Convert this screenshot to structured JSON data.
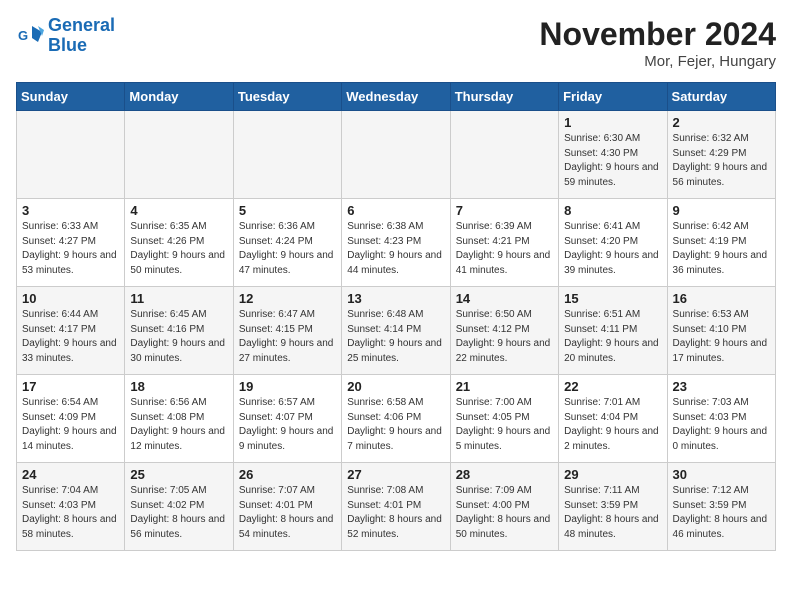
{
  "header": {
    "logo_line1": "General",
    "logo_line2": "Blue",
    "month": "November 2024",
    "location": "Mor, Fejer, Hungary"
  },
  "days_of_week": [
    "Sunday",
    "Monday",
    "Tuesday",
    "Wednesday",
    "Thursday",
    "Friday",
    "Saturday"
  ],
  "weeks": [
    [
      {
        "num": "",
        "info": ""
      },
      {
        "num": "",
        "info": ""
      },
      {
        "num": "",
        "info": ""
      },
      {
        "num": "",
        "info": ""
      },
      {
        "num": "",
        "info": ""
      },
      {
        "num": "1",
        "info": "Sunrise: 6:30 AM\nSunset: 4:30 PM\nDaylight: 9 hours and 59 minutes."
      },
      {
        "num": "2",
        "info": "Sunrise: 6:32 AM\nSunset: 4:29 PM\nDaylight: 9 hours and 56 minutes."
      }
    ],
    [
      {
        "num": "3",
        "info": "Sunrise: 6:33 AM\nSunset: 4:27 PM\nDaylight: 9 hours and 53 minutes."
      },
      {
        "num": "4",
        "info": "Sunrise: 6:35 AM\nSunset: 4:26 PM\nDaylight: 9 hours and 50 minutes."
      },
      {
        "num": "5",
        "info": "Sunrise: 6:36 AM\nSunset: 4:24 PM\nDaylight: 9 hours and 47 minutes."
      },
      {
        "num": "6",
        "info": "Sunrise: 6:38 AM\nSunset: 4:23 PM\nDaylight: 9 hours and 44 minutes."
      },
      {
        "num": "7",
        "info": "Sunrise: 6:39 AM\nSunset: 4:21 PM\nDaylight: 9 hours and 41 minutes."
      },
      {
        "num": "8",
        "info": "Sunrise: 6:41 AM\nSunset: 4:20 PM\nDaylight: 9 hours and 39 minutes."
      },
      {
        "num": "9",
        "info": "Sunrise: 6:42 AM\nSunset: 4:19 PM\nDaylight: 9 hours and 36 minutes."
      }
    ],
    [
      {
        "num": "10",
        "info": "Sunrise: 6:44 AM\nSunset: 4:17 PM\nDaylight: 9 hours and 33 minutes."
      },
      {
        "num": "11",
        "info": "Sunrise: 6:45 AM\nSunset: 4:16 PM\nDaylight: 9 hours and 30 minutes."
      },
      {
        "num": "12",
        "info": "Sunrise: 6:47 AM\nSunset: 4:15 PM\nDaylight: 9 hours and 27 minutes."
      },
      {
        "num": "13",
        "info": "Sunrise: 6:48 AM\nSunset: 4:14 PM\nDaylight: 9 hours and 25 minutes."
      },
      {
        "num": "14",
        "info": "Sunrise: 6:50 AM\nSunset: 4:12 PM\nDaylight: 9 hours and 22 minutes."
      },
      {
        "num": "15",
        "info": "Sunrise: 6:51 AM\nSunset: 4:11 PM\nDaylight: 9 hours and 20 minutes."
      },
      {
        "num": "16",
        "info": "Sunrise: 6:53 AM\nSunset: 4:10 PM\nDaylight: 9 hours and 17 minutes."
      }
    ],
    [
      {
        "num": "17",
        "info": "Sunrise: 6:54 AM\nSunset: 4:09 PM\nDaylight: 9 hours and 14 minutes."
      },
      {
        "num": "18",
        "info": "Sunrise: 6:56 AM\nSunset: 4:08 PM\nDaylight: 9 hours and 12 minutes."
      },
      {
        "num": "19",
        "info": "Sunrise: 6:57 AM\nSunset: 4:07 PM\nDaylight: 9 hours and 9 minutes."
      },
      {
        "num": "20",
        "info": "Sunrise: 6:58 AM\nSunset: 4:06 PM\nDaylight: 9 hours and 7 minutes."
      },
      {
        "num": "21",
        "info": "Sunrise: 7:00 AM\nSunset: 4:05 PM\nDaylight: 9 hours and 5 minutes."
      },
      {
        "num": "22",
        "info": "Sunrise: 7:01 AM\nSunset: 4:04 PM\nDaylight: 9 hours and 2 minutes."
      },
      {
        "num": "23",
        "info": "Sunrise: 7:03 AM\nSunset: 4:03 PM\nDaylight: 9 hours and 0 minutes."
      }
    ],
    [
      {
        "num": "24",
        "info": "Sunrise: 7:04 AM\nSunset: 4:03 PM\nDaylight: 8 hours and 58 minutes."
      },
      {
        "num": "25",
        "info": "Sunrise: 7:05 AM\nSunset: 4:02 PM\nDaylight: 8 hours and 56 minutes."
      },
      {
        "num": "26",
        "info": "Sunrise: 7:07 AM\nSunset: 4:01 PM\nDaylight: 8 hours and 54 minutes."
      },
      {
        "num": "27",
        "info": "Sunrise: 7:08 AM\nSunset: 4:01 PM\nDaylight: 8 hours and 52 minutes."
      },
      {
        "num": "28",
        "info": "Sunrise: 7:09 AM\nSunset: 4:00 PM\nDaylight: 8 hours and 50 minutes."
      },
      {
        "num": "29",
        "info": "Sunrise: 7:11 AM\nSunset: 3:59 PM\nDaylight: 8 hours and 48 minutes."
      },
      {
        "num": "30",
        "info": "Sunrise: 7:12 AM\nSunset: 3:59 PM\nDaylight: 8 hours and 46 minutes."
      }
    ]
  ]
}
